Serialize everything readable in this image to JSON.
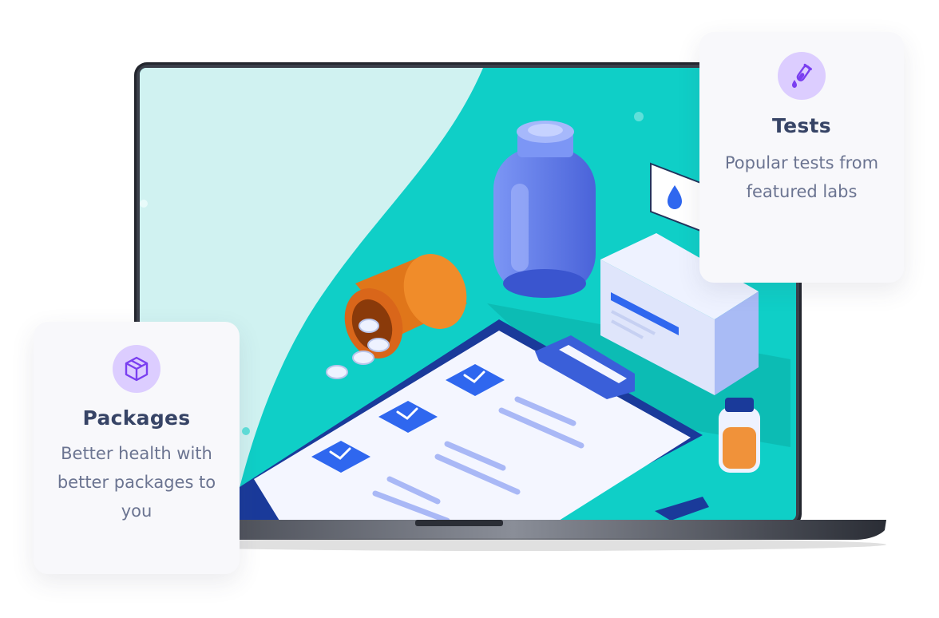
{
  "cards": {
    "tests": {
      "icon": "test-tube-icon",
      "title": "Tests",
      "description": "Popular tests from featured labs"
    },
    "packages": {
      "icon": "package-box-icon",
      "title": "Packages",
      "description": "Better health with better packages to you"
    }
  },
  "colors": {
    "screen_teal": "#0fcfc7",
    "screen_light": "#d0f2f1",
    "icon_bg": "#dccdff",
    "icon_fg": "#7a3ff0",
    "title": "#374466",
    "text": "#6b7491"
  }
}
